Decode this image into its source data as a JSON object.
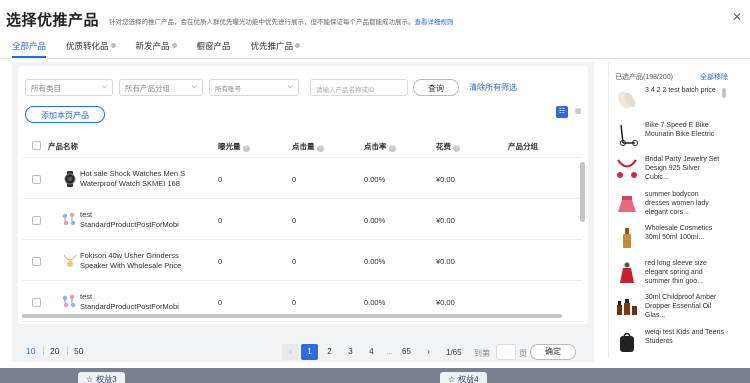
{
  "modal": {
    "title": "选择优推产品",
    "subtitle": "针对您选择的推广产品，会在优质人群优先曝光功能中优先进行展示，但不能保证每个产品都能成功展示。",
    "rules_link": "查看详细规则",
    "close_icon": "close-icon"
  },
  "tabs": [
    {
      "label": "全部产品",
      "active": true,
      "dot": false
    },
    {
      "label": "优质转化品",
      "active": false,
      "dot": true
    },
    {
      "label": "新发产品",
      "active": false,
      "dot": true
    },
    {
      "label": "橱窗产品",
      "active": false,
      "dot": false
    },
    {
      "label": "优先推广品",
      "active": false,
      "dot": true
    }
  ],
  "filters": {
    "category": "所有类目",
    "group": "所有产品分组",
    "account": "所有账号",
    "search_placeholder": "请输入产品名称或ID",
    "query_btn": "查询",
    "clear_link": "清除所有筛选"
  },
  "add_btn": "添加本页产品",
  "table": {
    "headers": {
      "name": "产品名称",
      "impressions": "曝光量",
      "clicks": "点击量",
      "ctr": "点击率",
      "cost": "花费",
      "group": "产品分组"
    },
    "rows": [
      {
        "name_line1": "Hot sale Shock Watches Men S",
        "name_line2": "Waterproof Watch SKMEI 168",
        "impressions": "0",
        "clicks": "0",
        "ctr": "0.00%",
        "cost": "¥0.00",
        "icon": "watch-icon"
      },
      {
        "name_line1": "test",
        "name_line2": "StandardProductPostForMobi",
        "impressions": "0",
        "clicks": "0",
        "ctr": "0.00%",
        "cost": "¥0.00",
        "icon": "flowers-icon"
      },
      {
        "name_line1": "Fokison 40w Usher Grinderss",
        "name_line2": "Speaker With Wholesale Price",
        "impressions": "0",
        "clicks": "0",
        "ctr": "0.00%",
        "cost": "¥0.00",
        "icon": "necklace-icon"
      },
      {
        "name_line1": "test",
        "name_line2": "StandardProductPostForMobi",
        "impressions": "0",
        "clicks": "0",
        "ctr": "0.00%",
        "cost": "¥0.00",
        "icon": "flowers-icon"
      }
    ]
  },
  "pager": {
    "sizes": [
      "10",
      "20",
      "50"
    ],
    "active_size": "10",
    "pages": [
      "1",
      "2",
      "3",
      "4",
      "...",
      "65"
    ],
    "current": "1/65",
    "goto_label": "到第",
    "page_suffix": "页",
    "confirm": "确定"
  },
  "selected": {
    "header": "已选产品(198/200)",
    "clear_all": "全部移除",
    "items": [
      {
        "label": "3 4 2 2 test batch price",
        "icon": "gloves-icon"
      },
      {
        "label": "Bike 7 Speed E Bike Mounatin Bike Electric",
        "icon": "scooter-icon"
      },
      {
        "label": "Bridal Party Jewelry Set Design 925 Silver Cubic...",
        "icon": "jewelry-icon"
      },
      {
        "label": "summer bodycon dresses women lady elegant cors...",
        "icon": "skirt-icon"
      },
      {
        "label": "Wholesale Cosmetics 30ml 50ml 100ml...",
        "icon": "bottle-icon"
      },
      {
        "label": "red long sleeve size elegant spring and summer thin goo...",
        "icon": "dress-icon"
      },
      {
        "label": "30ml Childproof Amber Dropper Essential Oil Glas...",
        "icon": "dropper-bottles-icon"
      },
      {
        "label": "weiqi test Kids and Teens Students",
        "icon": "backpack-icon"
      }
    ]
  },
  "backdrop": {
    "badge1": "权益3",
    "badge2": "权益4"
  }
}
